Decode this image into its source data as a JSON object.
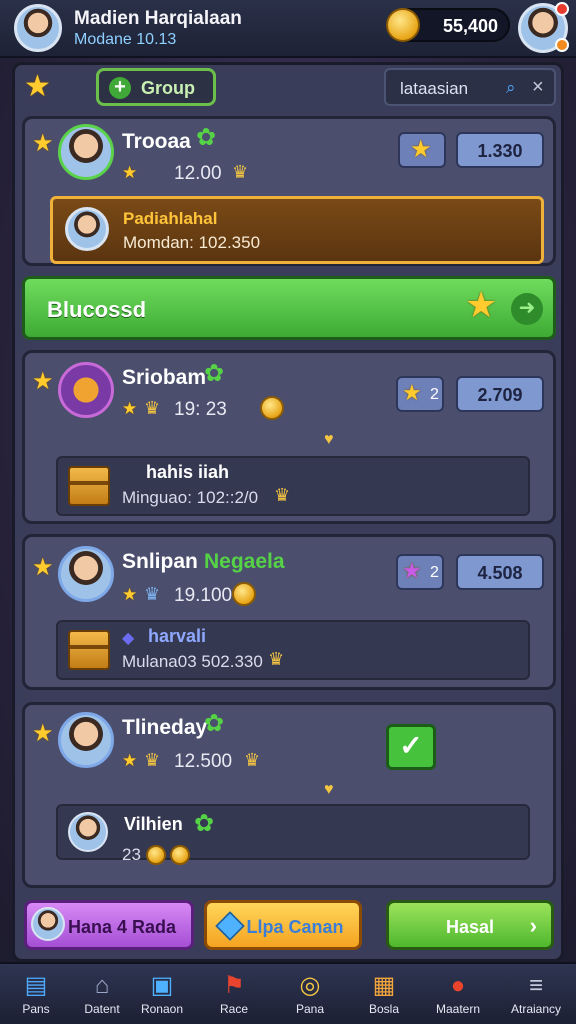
{
  "header": {
    "player_name": "Madien Harqialaan",
    "player_subtitle": "Modane 10.13",
    "coins": "55,400"
  },
  "toolbar": {
    "group_label": "Group",
    "search_text": "lataasian"
  },
  "top_card": {
    "name": "Trooaa",
    "score_line": "12.00",
    "score_box": "1.330",
    "highlight": {
      "title": "Padiahlahal",
      "value": "Momdan: 102.350"
    }
  },
  "success_bar": {
    "label": "Blucossd"
  },
  "cards": [
    {
      "name": "Sriobam",
      "score_line": "19: 23",
      "star_count": "2",
      "score_box": "2.709",
      "sub_title": "hahis iiah",
      "sub_value": "Minguao: 102::2/0"
    },
    {
      "name": "Snlipan",
      "tag": "Negaela",
      "score_line": "19.100",
      "star_count": "2",
      "score_box": "4.508",
      "sub_title": "harvali",
      "sub_value": "Mulana03 502.330"
    },
    {
      "name": "Tlineday",
      "score_line": "12.500",
      "sub_title": "Vilhien",
      "sub_value": "23"
    }
  ],
  "actions": {
    "purple": "Hana 4 Rada",
    "orange": "Llpa Canan",
    "green": "Hasal"
  },
  "nav": [
    {
      "label": "Pans",
      "icon": "news-icon"
    },
    {
      "label": "Datent",
      "icon": "home-icon"
    },
    {
      "label": "Ronaon",
      "icon": "cube-icon"
    },
    {
      "label": "Race",
      "icon": "flag-icon"
    },
    {
      "label": "Pana",
      "icon": "coin-icon"
    },
    {
      "label": "Bosla",
      "icon": "chest-icon"
    },
    {
      "label": "Maatern",
      "icon": "profile-icon"
    },
    {
      "label": "Atraiancy",
      "icon": "menu-icon"
    }
  ],
  "colors": {
    "accent_green": "#4fb82e",
    "accent_gold": "#f0b13a",
    "panel": "#4b4f6d"
  }
}
